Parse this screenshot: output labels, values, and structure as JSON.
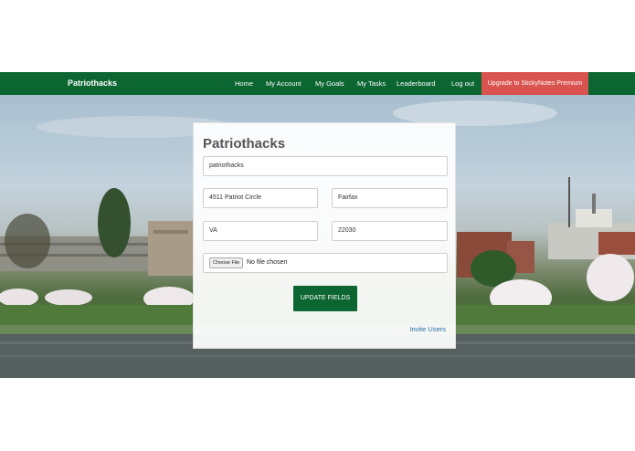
{
  "nav": {
    "brand": "Patriothacks",
    "links": [
      "Home",
      "My Account",
      "My Goals",
      "My Tasks",
      "Leaderboard",
      "Log out"
    ],
    "premium": "Upgrade to StickyNotes Premium"
  },
  "form": {
    "title": "Patriothacks",
    "name": "patriothacks",
    "street": "4511 Patriot Circle",
    "city": "Fairfax",
    "state": "VA",
    "zip": "22030",
    "file_button": "Choose File",
    "file_status": "No file chosen",
    "submit": "UPDATE FIELDS",
    "invite": "Invite Users"
  },
  "colors": {
    "brand_green": "#0c6632",
    "premium_red": "#d9534f",
    "link_blue": "#2a6db0"
  }
}
